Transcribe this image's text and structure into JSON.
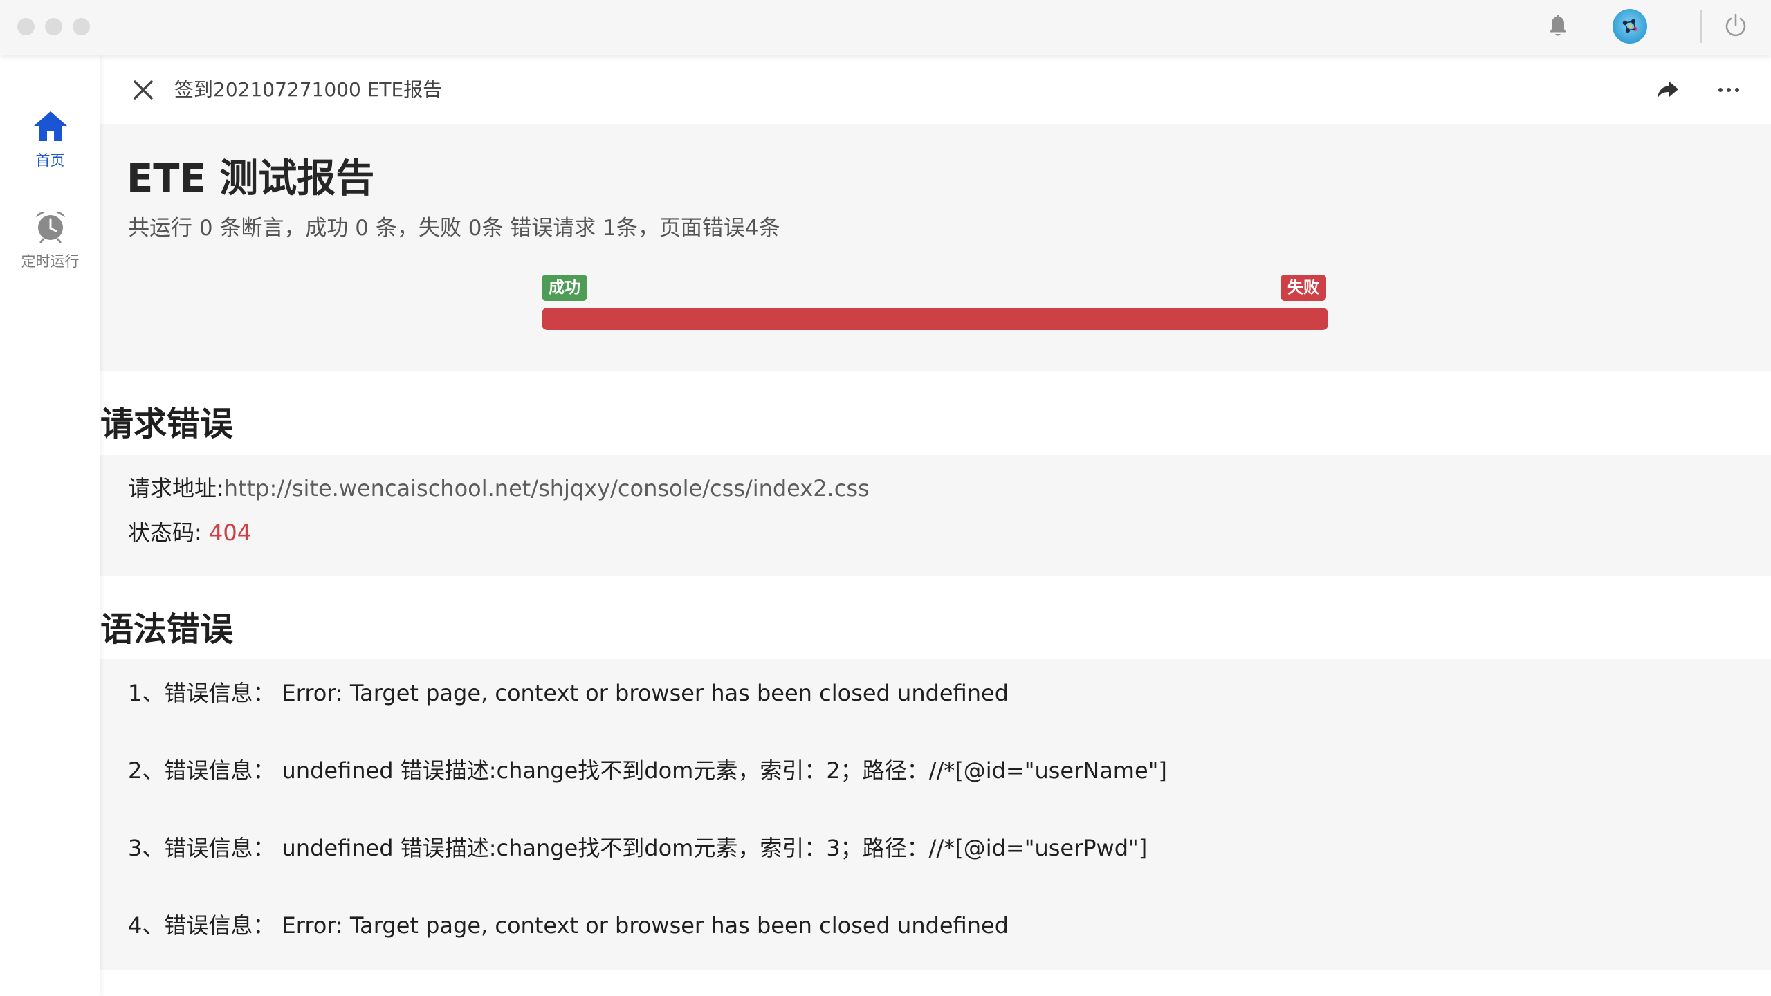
{
  "sidebar": {
    "items": [
      {
        "label": "首页",
        "icon": "home-icon",
        "active": true
      },
      {
        "label": "定时运行",
        "icon": "alarm-clock-icon",
        "active": false
      }
    ]
  },
  "header": {
    "title": "签到202107271000 ETE报告"
  },
  "report": {
    "title": "ETE 测试报告",
    "stats": "共运行 0 条断言，成功 0 条，失败 0条 错误请求 1条，页面错误4条",
    "success_label": "成功",
    "fail_label": "失败",
    "fail_fraction": 1.0
  },
  "request_errors": {
    "heading": "请求错误",
    "url_key": "请求地址:",
    "url": "http://site.wencaischool.net/shjqxy/console/css/index2.css",
    "status_key": "状态码: ",
    "status": "404"
  },
  "syntax_errors": {
    "heading": "语法错误",
    "items": [
      "1、错误信息： Error: Target page, context or browser has been closed undefined",
      "2、错误信息： undefined 错误描述:change找不到dom元素，索引：2；路径：//*[@id=\"userName\"]",
      "3、错误信息： undefined 错误描述:change找不到dom元素，索引：3；路径：//*[@id=\"userPwd\"]",
      "4、错误信息： Error: Target page, context or browser has been closed undefined"
    ]
  },
  "colors": {
    "accent_blue": "#1a55d6",
    "success_green": "#4e9c55",
    "fail_red": "#cc4046"
  }
}
